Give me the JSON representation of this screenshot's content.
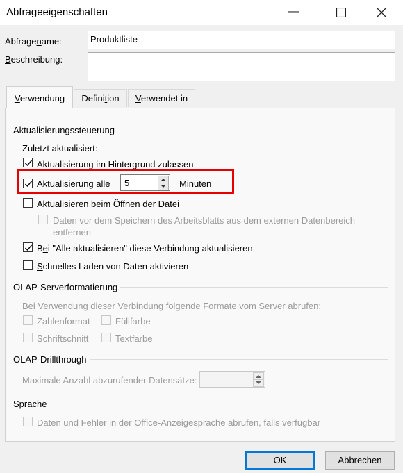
{
  "window": {
    "title": "Abfrageeigenschaften"
  },
  "form": {
    "name_label_pre": "Abfrage",
    "name_label_u": "n",
    "name_label_post": "ame:",
    "name_value": "Produktliste",
    "desc_label_u": "B",
    "desc_label_post": "eschreibung:",
    "desc_value": ""
  },
  "tabs": [
    {
      "u": "V",
      "rest": "erwendung",
      "active": true
    },
    {
      "pre": "Defini",
      "u": "t",
      "post": "ion",
      "active": false
    },
    {
      "u": "V",
      "rest": "erwendet in",
      "active": false
    }
  ],
  "refresh": {
    "group": "Aktualisierungssteuerung",
    "last_refreshed": "Zuletzt aktualisiert:",
    "background_pre": "Aktualisierung im Hinter",
    "background_u": "g",
    "background_post": "rund zulassen",
    "background_checked": true,
    "every_u": "A",
    "every_post": "ktualisierung alle",
    "every_checked": true,
    "every_value": "5",
    "minutes": "Minuten",
    "on_open_pre": "Ak",
    "on_open_u": "t",
    "on_open_post": "ualisieren beim Öffnen der Datei",
    "on_open_checked": false,
    "remove_data_line1": "Daten vor dem Speichern des Arbeitsblatts aus dem externen Datenbereich",
    "remove_data_line2": "entfernen",
    "refresh_all_pre": "B",
    "refresh_all_u": "e",
    "refresh_all_post": "i \"Alle aktualisieren\" diese Verbindung aktualisieren",
    "refresh_all_checked": true,
    "fast_load_u": "S",
    "fast_load_post": "chnelles Laden von Daten aktivieren",
    "fast_load_checked": false
  },
  "olap_format": {
    "group": "OLAP-Serverformatierung",
    "desc": "Bei Verwendung dieser Verbindung folgende Formate vom Server abrufen:",
    "number_format": "Zahlenformat",
    "fill_color": "Füllfarbe",
    "font_style": "Schriftschnitt",
    "text_color": "Textfarbe"
  },
  "olap_drill": {
    "group": "OLAP-Drillthrough",
    "max_records": "Maximale Anzahl abzurufender Datensätze:",
    "max_value": ""
  },
  "language": {
    "group": "Sprache",
    "office_lang": "Daten und Fehler in der Office-Anzeigesprache abrufen, falls verfügbar"
  },
  "buttons": {
    "ok": "OK",
    "cancel": "Abbrechen"
  },
  "colors": {
    "highlight_box": "#e60000",
    "default_button_border": "#0078d7"
  }
}
